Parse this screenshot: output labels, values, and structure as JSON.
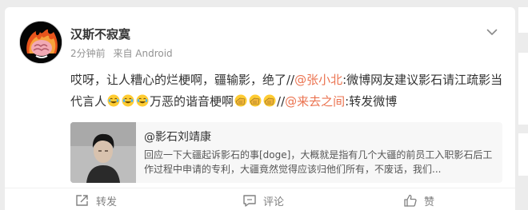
{
  "post": {
    "username": "汉斯不寂寞",
    "time": "2分钟前",
    "source": "来自 Android",
    "text": {
      "part1": "哎呀，让人糟心的烂梗啊，疆输影，绝了//",
      "mention1": "@张小北",
      "part2": ":微博网友建议影石请江疏影当代言人",
      "emoji1": "laugh-cry-emoji",
      "part3": "万恶的谐音梗啊",
      "emoji2": "facepalm-emoji",
      "part4": "//",
      "mention2": "@来去之间",
      "part5": ":转发微博"
    }
  },
  "repost": {
    "author": "@影石刘靖康",
    "body": "回应一下大疆起诉影石的事[doge]，大概就是指有几个大疆的前员工入职影石后工作过程中申请的专利，大疆竟然觉得应该归他们所有，不废话，我们..."
  },
  "actions": {
    "repost_label": "转发",
    "comment_label": "评论",
    "like_label": "赞"
  },
  "icons": {
    "more": "chevron-down-icon",
    "repost": "share-icon",
    "comment": "comment-icon",
    "like": "thumbs-up-icon"
  },
  "colors": {
    "link": "#eb7350",
    "meta": "#939393",
    "background": "#ececec"
  }
}
